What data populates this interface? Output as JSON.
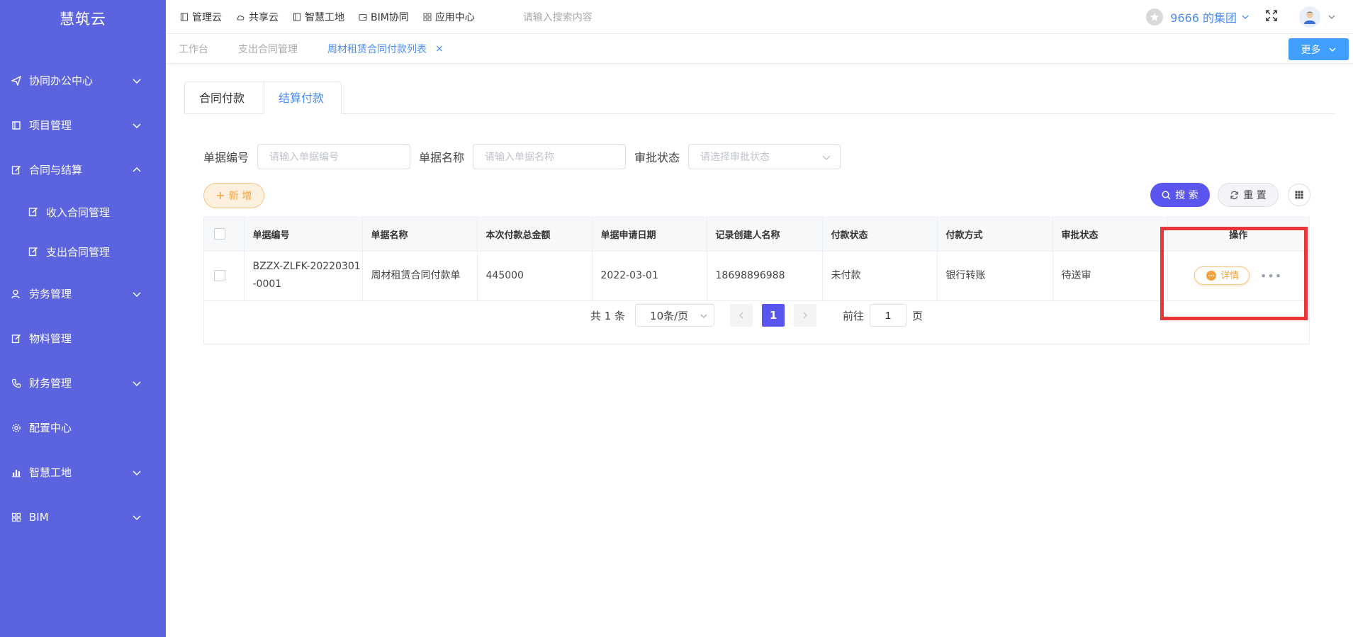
{
  "app": {
    "logo": "慧筑云"
  },
  "sidebar": {
    "items": [
      {
        "label": "协同办公中心",
        "icon": "send-icon",
        "expandable": true
      },
      {
        "label": "项目管理",
        "icon": "book-icon",
        "expandable": true
      },
      {
        "label": "合同与结算",
        "icon": "edit-icon",
        "expandable": true,
        "expanded": true
      },
      {
        "label": "劳务管理",
        "icon": "worker-icon",
        "expandable": true
      },
      {
        "label": "物料管理",
        "icon": "edit-icon",
        "expandable": false
      },
      {
        "label": "财务管理",
        "icon": "phone-icon",
        "expandable": true
      },
      {
        "label": "配置中心",
        "icon": "gear-icon",
        "expandable": false
      },
      {
        "label": "智慧工地",
        "icon": "bar-chart-icon",
        "expandable": true
      },
      {
        "label": "BIM",
        "icon": "grid-icon",
        "expandable": true
      }
    ],
    "sub_items": [
      {
        "label": "收入合同管理"
      },
      {
        "label": "支出合同管理"
      }
    ]
  },
  "topbar": {
    "links": [
      {
        "label": "管理云"
      },
      {
        "label": "共享云"
      },
      {
        "label": "智慧工地"
      },
      {
        "label": "BIM协同"
      },
      {
        "label": "应用中心"
      }
    ],
    "search_placeholder": "请输入搜索内容",
    "org_name": "9666 的集团"
  },
  "page_tabs": {
    "items": [
      {
        "label": "工作台"
      },
      {
        "label": "支出合同管理"
      },
      {
        "label": "周材租赁合同付款列表",
        "active": true,
        "closable": true
      }
    ],
    "close_symbol": "×",
    "more_label": "更多"
  },
  "content_tabs": [
    {
      "label": "合同付款"
    },
    {
      "label": "结算付款",
      "active": true
    }
  ],
  "filters": {
    "doc_no_label": "单据编号",
    "doc_no_placeholder": "请输入单据编号",
    "doc_name_label": "单据名称",
    "doc_name_placeholder": "请输入单据名称",
    "status_label": "审批状态",
    "status_placeholder": "请选择审批状态"
  },
  "actions": {
    "add_label": "新 增",
    "search_label": "搜 索",
    "reset_label": "重 置"
  },
  "table": {
    "columns": [
      "单据编号",
      "单据名称",
      "本次付款总金额",
      "单据申请日期",
      "记录创建人名称",
      "付款状态",
      "付款方式",
      "审批状态",
      "操作"
    ],
    "rows": [
      {
        "doc_no": "BZZX-ZLFK-20220301-0001",
        "doc_name": "周材租赁合同付款单",
        "amount": "445000",
        "date": "2022-03-01",
        "creator": "18698896988",
        "pay_status": "未付款",
        "pay_method": "银行转账",
        "approval": "待送审",
        "detail_label": "详情",
        "more_symbol": "•••"
      }
    ]
  },
  "pagination": {
    "total_text": "共 1 条",
    "page_size": "10条/页",
    "current_page": "1",
    "goto_prefix": "前往",
    "goto_value": "1",
    "goto_suffix": "页"
  },
  "colors": {
    "sidebar": "#5b63df",
    "primary": "#5b55ef",
    "link": "#4a8cf7",
    "warning": "#f5a13b",
    "highlight": "#e8373a"
  }
}
